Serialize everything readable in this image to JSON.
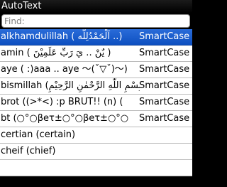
{
  "window": {
    "title": "AutoText"
  },
  "search": {
    "placeholder": "Find:"
  },
  "entries": [
    {
      "text": "alkhamdulillah ( اَلْحَمْدُلِلّه ..)",
      "type": "SmartCase",
      "selected": true
    },
    {
      "text": "amin ( يٌنْ .. يَ رَبِّ عَلَمِيْنَ )",
      "type": "SmartCase",
      "selected": false
    },
    {
      "text": "aye ( :)aaa .. aye ～(ˇ▽ˇ)～)",
      "type": "SmartCase",
      "selected": false
    },
    {
      "text": "bismillah (بِسْمِ اللّٰهِ الرَّحْمٰنِ الرَّحِيْمِ",
      "type": "SmartCase",
      "selected": false
    },
    {
      "text": "brot ((>*<)  :p BRUT!! (n) (",
      "type": "SmartCase",
      "selected": false
    },
    {
      "text": "bt (○°○βeτ±○°○βeτ±○°○",
      "type": "SmartCase",
      "selected": false
    },
    {
      "text": "certian (certain)",
      "type": "",
      "selected": false
    },
    {
      "text": "cheif (chief)",
      "type": "",
      "selected": false
    },
    {
      "text": "",
      "type": "",
      "selected": false
    }
  ]
}
